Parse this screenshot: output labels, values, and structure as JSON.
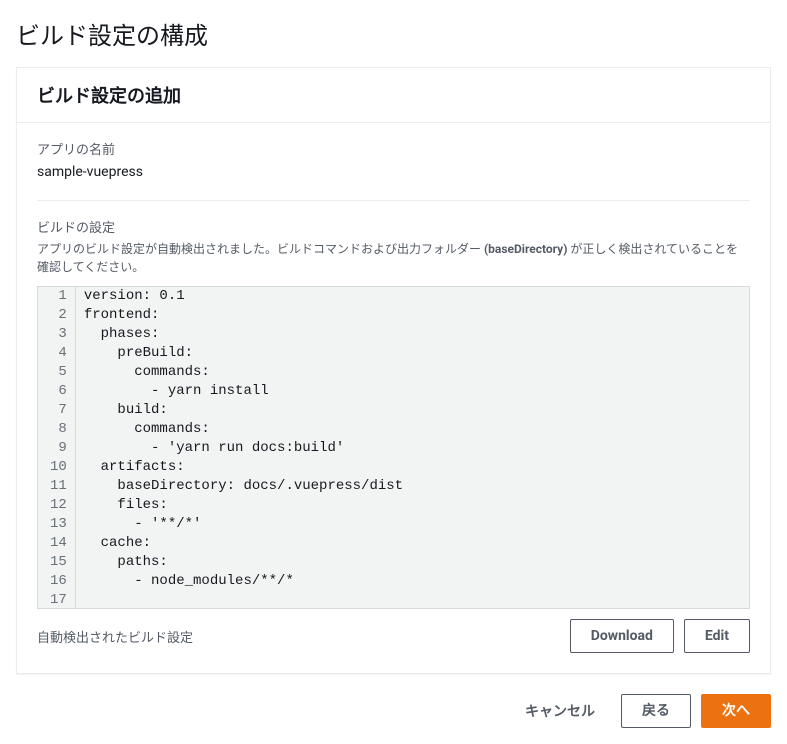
{
  "page": {
    "title": "ビルド設定の構成"
  },
  "panel": {
    "header": "ビルド設定の追加",
    "appNameLabel": "アプリの名前",
    "appNameValue": "sample-vuepress",
    "buildSettingsLabel": "ビルドの設定",
    "buildSettingsDescA": "アプリのビルド設定が自動検出されました。ビルドコマンドおよび出力フォルダー ",
    "buildSettingsDescStrong": "(baseDirectory)",
    "buildSettingsDescB": " が正しく検出されていることを確認してください。",
    "autoDetectedLabel": "自動検出されたビルド設定",
    "downloadLabel": "Download",
    "editLabel": "Edit"
  },
  "code": {
    "lines": [
      "version: 0.1",
      "frontend:",
      "  phases:",
      "    preBuild:",
      "      commands:",
      "        - yarn install",
      "    build:",
      "      commands:",
      "        - 'yarn run docs:build'",
      "  artifacts:",
      "    baseDirectory: docs/.vuepress/dist",
      "    files:",
      "      - '**/*'",
      "  cache:",
      "    paths:",
      "      - node_modules/**/*",
      ""
    ]
  },
  "actions": {
    "cancel": "キャンセル",
    "back": "戻る",
    "next": "次へ"
  }
}
